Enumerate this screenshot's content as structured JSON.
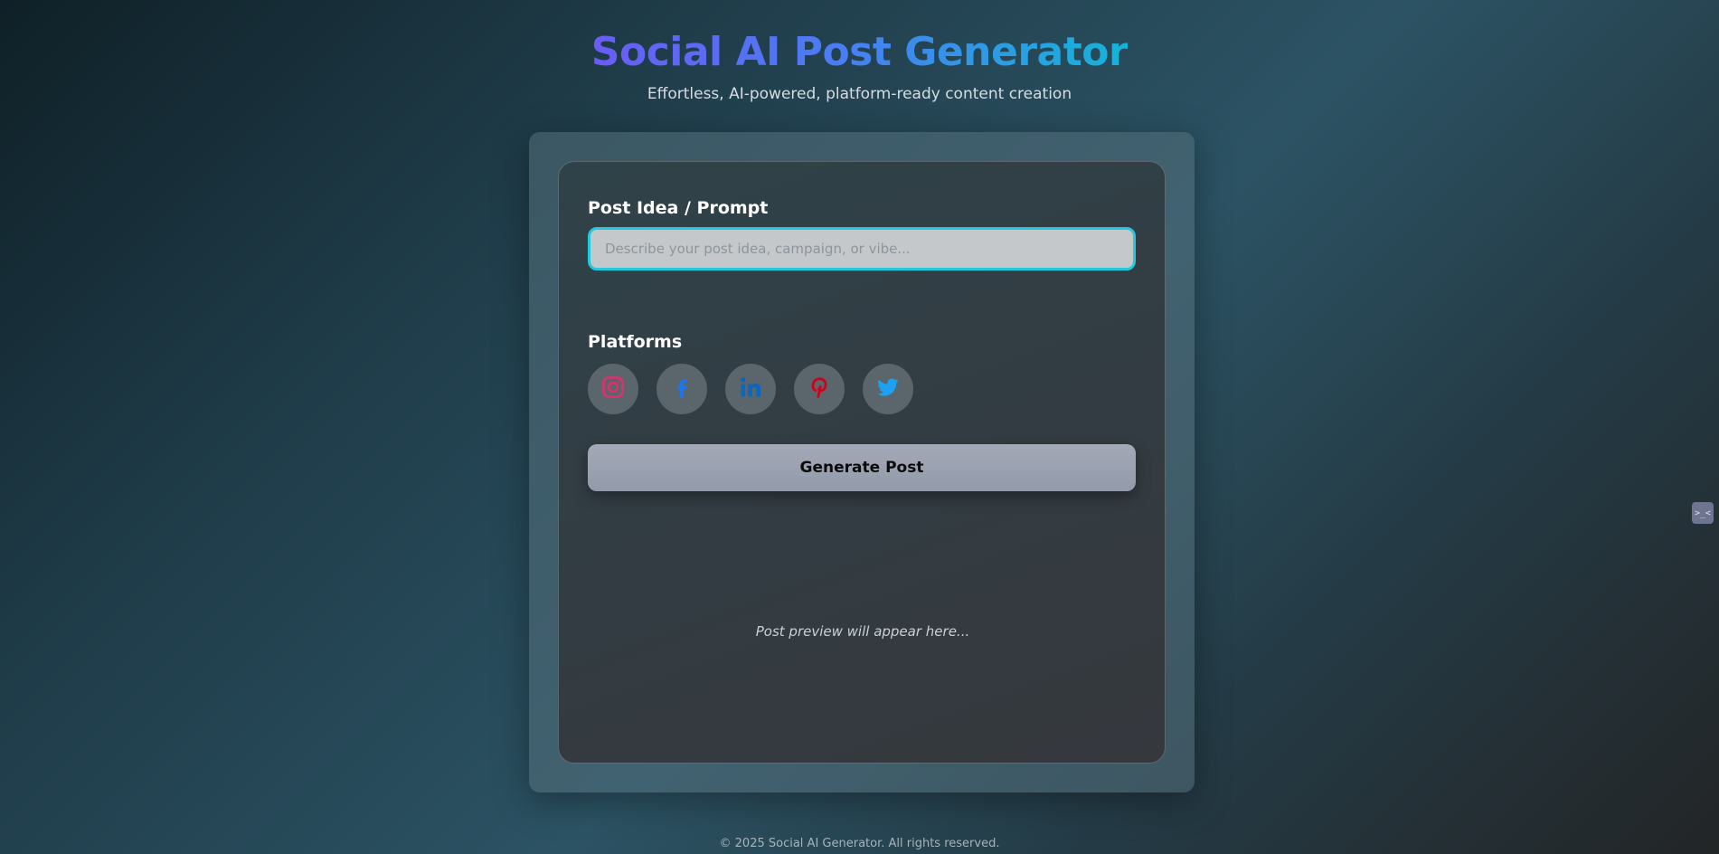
{
  "header": {
    "title": "Social AI Post Generator",
    "subtitle": "Effortless, AI-powered, platform-ready content creation"
  },
  "form": {
    "prompt_label": "Post Idea / Prompt",
    "prompt_placeholder": "Describe your post idea, campaign, or vibe...",
    "prompt_value": "",
    "platforms_label": "Platforms",
    "platforms": [
      {
        "name": "Instagram",
        "icon": "instagram-icon",
        "color": "#e1306c"
      },
      {
        "name": "Facebook",
        "icon": "facebook-icon",
        "color": "#1877f2"
      },
      {
        "name": "LinkedIn",
        "icon": "linkedin-icon",
        "color": "#0a66c2"
      },
      {
        "name": "Pinterest",
        "icon": "pinterest-icon",
        "color": "#d0021b"
      },
      {
        "name": "Twitter",
        "icon": "twitter-icon",
        "color": "#1da1f2"
      }
    ],
    "generate_label": "Generate Post"
  },
  "preview": {
    "placeholder": "Post preview will appear here..."
  },
  "footer": {
    "text": "© 2025 Social AI Generator. All rights reserved."
  },
  "side_widget": {
    "label": ">_<"
  },
  "colors": {
    "accent_border": "#22c8dc",
    "title_gradient_start": "#6a5cf5",
    "title_gradient_end": "#15b4d8"
  }
}
